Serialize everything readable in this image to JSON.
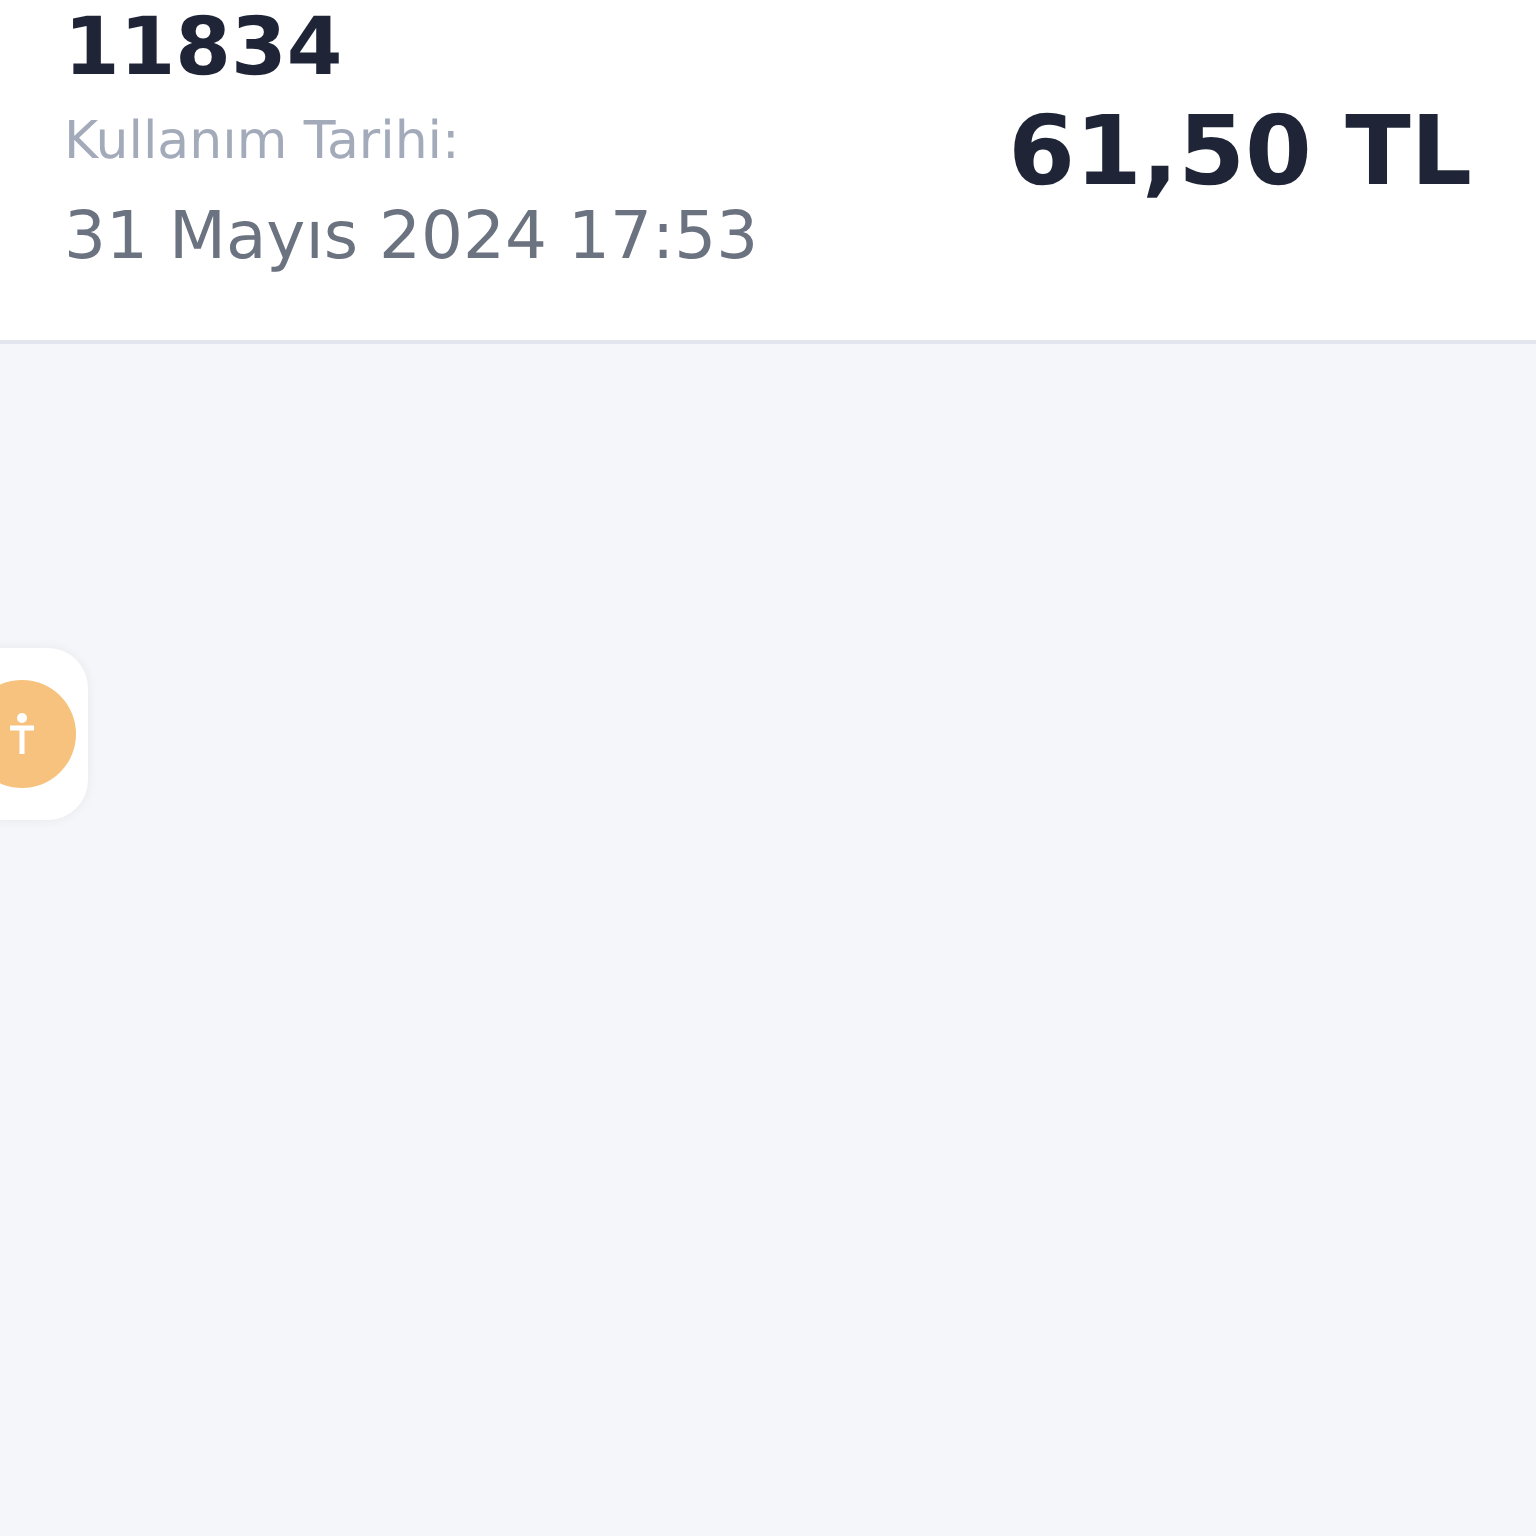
{
  "transaction": {
    "number": "11834",
    "date_label": "Kullanım Tarihi:",
    "date": "31 Mayıs 2024 17:53",
    "amount": "61,50 TL"
  }
}
